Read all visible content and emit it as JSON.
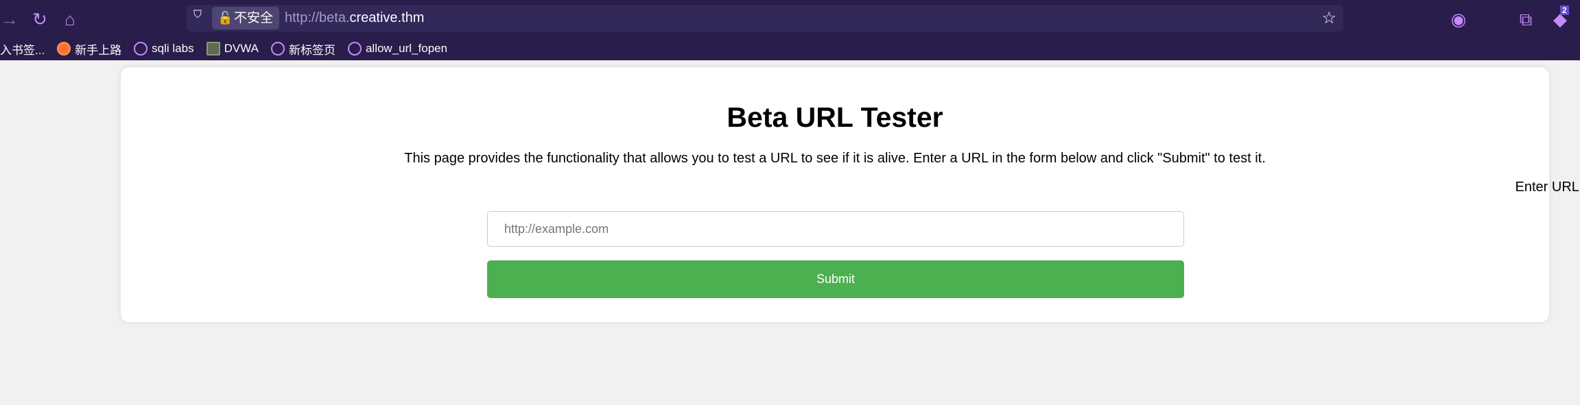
{
  "browser": {
    "insecure_label": "不安全",
    "url_prefix": "http://beta.",
    "url_domain": "creative.thm",
    "extension_badge": "2",
    "bookmarks": [
      {
        "label": "入书签...",
        "icon": "none"
      },
      {
        "label": "新手上路",
        "icon": "firefox-icon"
      },
      {
        "label": "sqli labs",
        "icon": "globe-icon"
      },
      {
        "label": "DVWA",
        "icon": "dvwa-icon"
      },
      {
        "label": "新标签页",
        "icon": "globe-icon"
      },
      {
        "label": "allow_url_fopen",
        "icon": "globe-icon"
      }
    ]
  },
  "page": {
    "title": "Beta URL Tester",
    "description": "This page provides the functionality that allows you to test a URL to see if it is alive. Enter a URL in the form below and click \"Submit\" to test it.",
    "url_label": "Enter URL:",
    "url_placeholder": "http://example.com",
    "url_value": "",
    "submit_label": "Submit"
  },
  "colors": {
    "accent": "#4caf50",
    "chrome": "#291d4b"
  }
}
